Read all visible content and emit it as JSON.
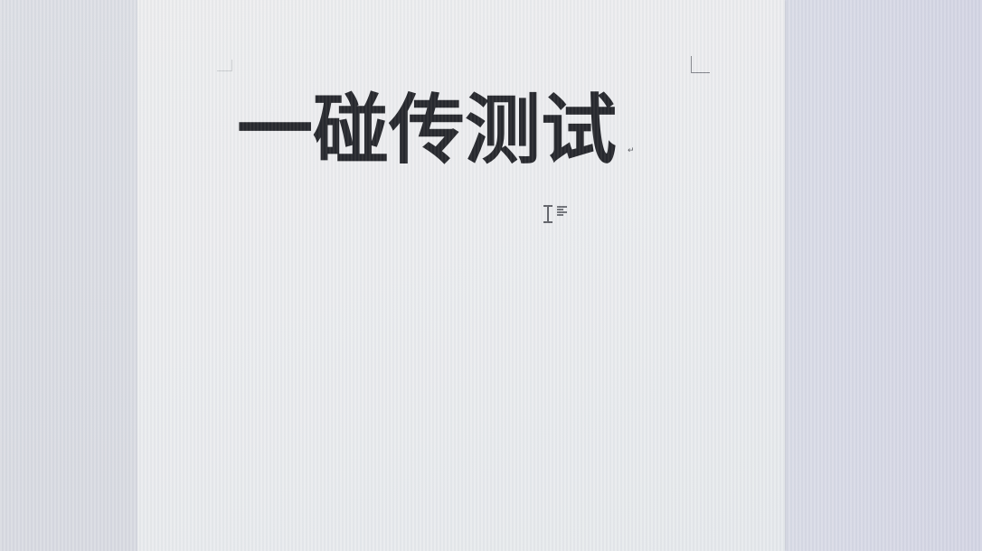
{
  "document": {
    "title": "一碰传测试"
  },
  "icons": {
    "paragraph_mark": "paragraph-mark-icon",
    "cursor": "i-beam-cursor-icon",
    "alignment": "left-align-icon"
  },
  "colors": {
    "page_background": "#ebecee",
    "workspace_background": "#dcdee4",
    "title_text": "#1c1d22"
  }
}
